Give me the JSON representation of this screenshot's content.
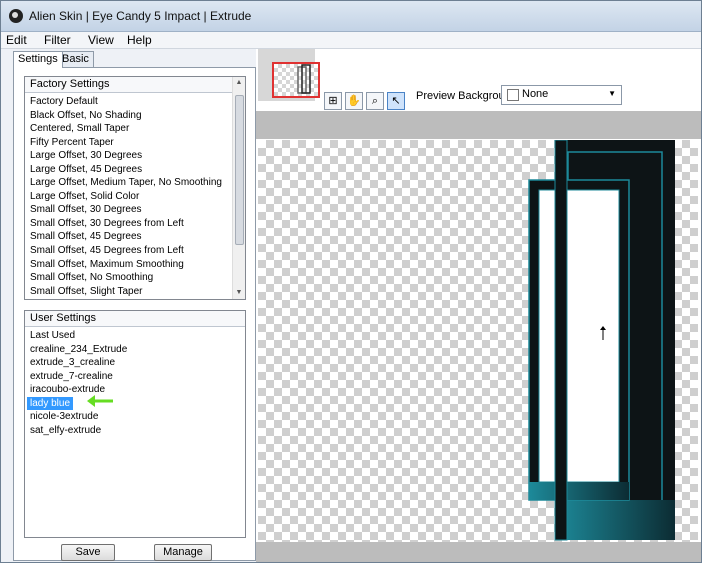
{
  "window": {
    "title": "Alien Skin | Eye Candy 5 Impact | Extrude"
  },
  "menu": [
    "Edit",
    "Filter",
    "View",
    "Help"
  ],
  "tabs": [
    {
      "label": "Settings",
      "active": true
    },
    {
      "label": "Basic",
      "active": false
    }
  ],
  "factory_settings": {
    "header": "Factory Settings",
    "items": [
      "Factory Default",
      "Black Offset, No Shading",
      "Centered, Small Taper",
      "Fifty Percent Taper",
      "Large Offset, 30 Degrees",
      "Large Offset, 45 Degrees",
      "Large Offset, Medium Taper, No Smoothing",
      "Large Offset, Solid Color",
      "Small Offset, 30 Degrees",
      "Small Offset, 30 Degrees from Left",
      "Small Offset, 45 Degrees",
      "Small Offset, 45 Degrees from Left",
      "Small Offset, Maximum Smoothing",
      "Small Offset, No Smoothing",
      "Small Offset, Slight Taper"
    ]
  },
  "user_settings": {
    "header": "User Settings",
    "items": [
      "Last Used",
      "crealine_234_Extrude",
      "extrude_3_crealine",
      "extrude_7-crealine",
      "iracoubo-extrude",
      "lady blue",
      "nicole-3extrude",
      "sat_elfy-extrude"
    ],
    "selected": "lady blue"
  },
  "buttons": {
    "save": "Save",
    "manage": "Manage"
  },
  "preview": {
    "background_label": "Preview Background:",
    "background_value": "None",
    "tools": [
      "navigator-icon",
      "hand-icon",
      "zoom-icon",
      "arrow-icon"
    ],
    "active_tool": "arrow-icon"
  },
  "colors": {
    "selection": "#3399ff",
    "extrude_teal": "#1d8a9a",
    "frame_dark": "#0d1416",
    "annotation_arrow": "#66dd22",
    "thumbnail_border": "#e03232"
  }
}
